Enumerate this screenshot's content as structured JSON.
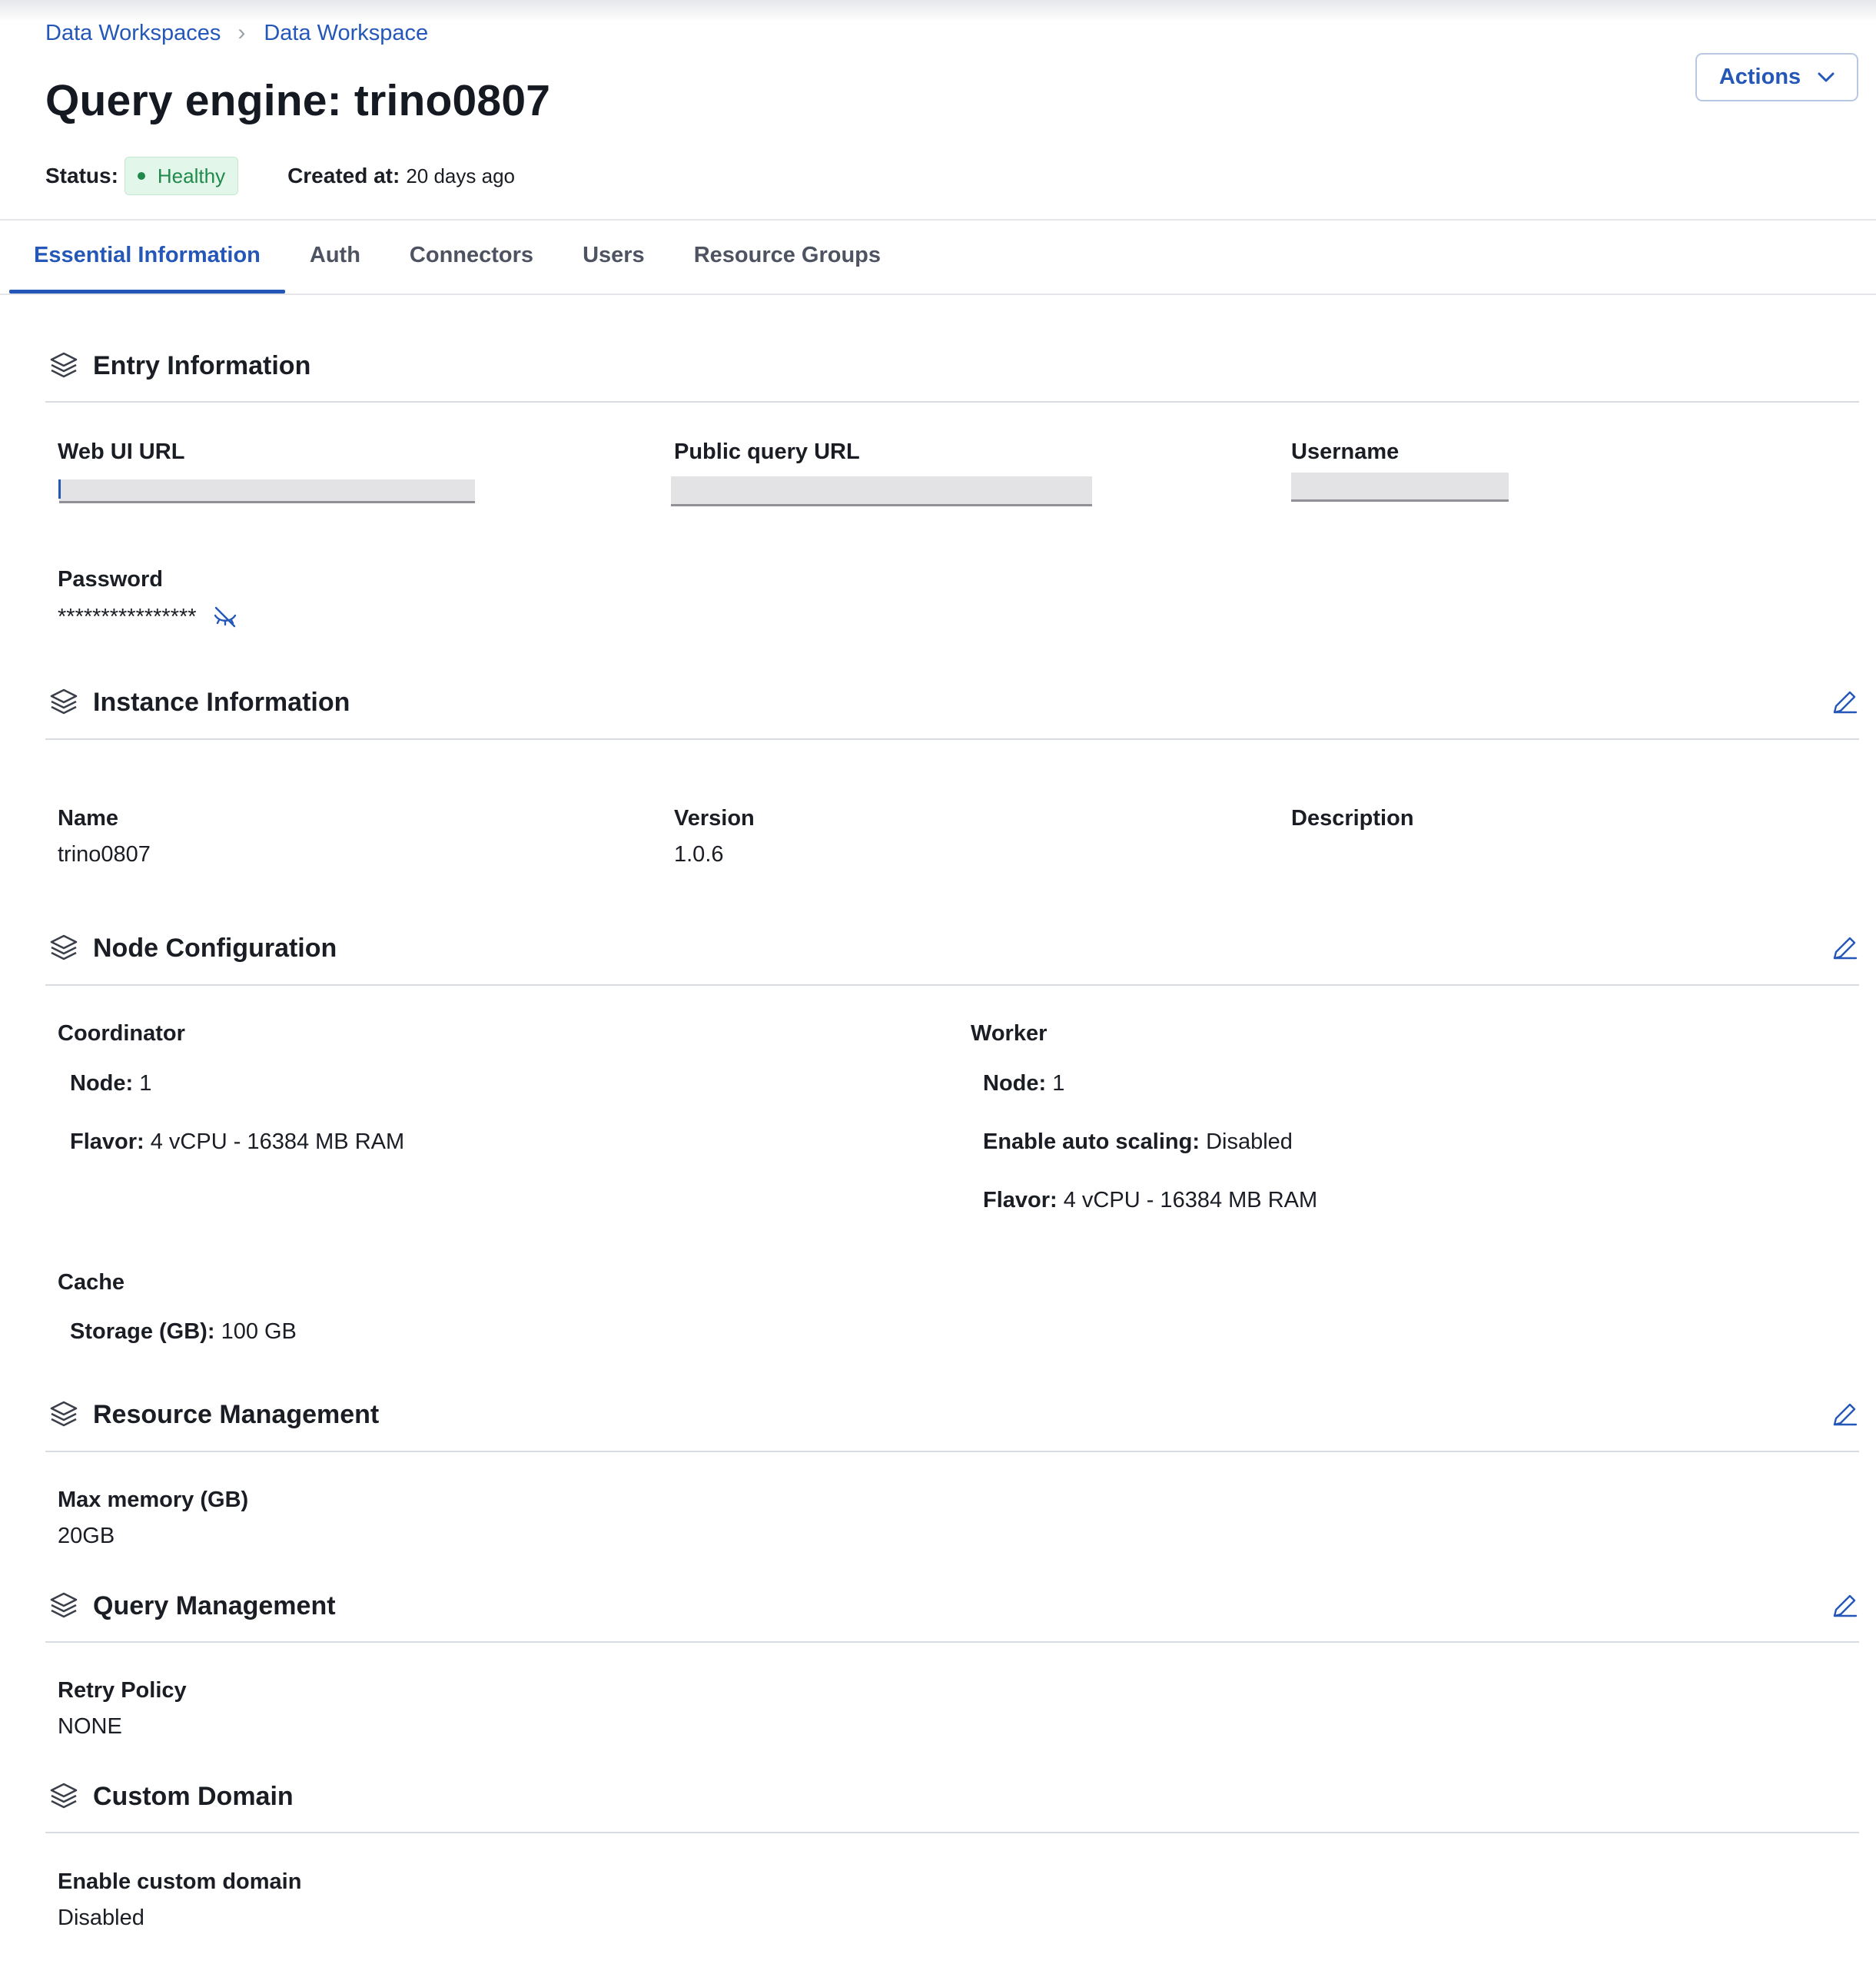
{
  "breadcrumb": [
    "Data Workspaces",
    "Data Workspace"
  ],
  "title": "Query engine: trino0807",
  "actions_label": "Actions",
  "status": {
    "label": "Status:",
    "value": "Healthy",
    "color": "#1f8a4c"
  },
  "created": {
    "label": "Created at:",
    "value": "20 days ago"
  },
  "tabs": [
    "Essential Information",
    "Auth",
    "Connectors",
    "Users",
    "Resource Groups"
  ],
  "active_tab": "Essential Information",
  "entry": {
    "title": "Entry Information",
    "web_ui_label": "Web UI URL",
    "public_query_label": "Public query URL",
    "username_label": "Username",
    "password_label": "Password",
    "password_value": "****************"
  },
  "instance": {
    "title": "Instance Information",
    "name_label": "Name",
    "name_value": "trino0807",
    "version_label": "Version",
    "version_value": "1.0.6",
    "description_label": "Description"
  },
  "node": {
    "title": "Node Configuration",
    "coordinator_label": "Coordinator",
    "coordinator_node_label": "Node:",
    "coordinator_node_value": "1",
    "coordinator_flavor_label": "Flavor:",
    "coordinator_flavor_value": "4 vCPU - 16384 MB RAM",
    "worker_label": "Worker",
    "worker_node_label": "Node:",
    "worker_node_value": "1",
    "worker_autoscale_label": "Enable auto scaling:",
    "worker_autoscale_value": "Disabled",
    "worker_flavor_label": "Flavor:",
    "worker_flavor_value": "4 vCPU - 16384 MB RAM",
    "cache_label": "Cache",
    "storage_label": "Storage (GB):",
    "storage_value": "100 GB"
  },
  "resource": {
    "title": "Resource Management",
    "max_memory_label": "Max memory (GB)",
    "max_memory_value": "20GB"
  },
  "query": {
    "title": "Query Management",
    "retry_label": "Retry Policy",
    "retry_value": "NONE"
  },
  "custom_domain": {
    "title": "Custom Domain",
    "enable_label": "Enable custom domain",
    "enable_value": "Disabled"
  },
  "colors": {
    "accent": "#2457b8",
    "text": "#1a1d24",
    "divider": "#d9dce1"
  },
  "icons": {
    "section": "layers-icon",
    "edit": "pencil-icon",
    "password_toggle": "eye-off-icon",
    "dropdown": "chevron-down-icon",
    "breadcrumb_separator": "chevron-right-icon"
  }
}
